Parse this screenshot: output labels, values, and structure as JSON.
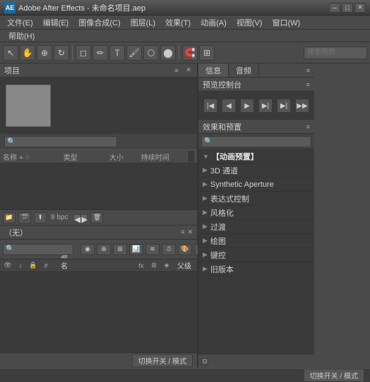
{
  "titleBar": {
    "logo": "AE",
    "title": "Adobe After Effects - 未命名项目.aep",
    "minBtn": "─",
    "maxBtn": "□",
    "closeBtn": "✕"
  },
  "menuBar": {
    "items": [
      {
        "id": "file",
        "label": "文件(E)"
      },
      {
        "id": "edit",
        "label": "编辑(E)"
      },
      {
        "id": "composition",
        "label": "图像合成(C)"
      },
      {
        "id": "layer",
        "label": "图层(L)"
      },
      {
        "id": "effect",
        "label": "效果(T)"
      },
      {
        "id": "animation",
        "label": "动画(A)"
      },
      {
        "id": "view",
        "label": "视图(V)"
      },
      {
        "id": "window",
        "label": "窗口(W)"
      }
    ],
    "helpItem": "帮助(H)"
  },
  "toolbar": {
    "tools": [
      "↖",
      "✋",
      "↔",
      "⊕",
      "⟺",
      "✏",
      "T",
      "☁",
      "⬡"
    ],
    "searchPlaceholder": "搜索帮助"
  },
  "projectPanel": {
    "title": "项目",
    "searchPlaceholder": "",
    "tableHeaders": {
      "name": "名称",
      "sortAsc": "▲",
      "tag": "◇",
      "type": "类型",
      "size": "大小",
      "duration": "持续时间"
    },
    "bottomBar": {
      "bpcLabel": "8 bpc"
    }
  },
  "infoAudioTabs": {
    "tabs": [
      "信息",
      "音频"
    ]
  },
  "previewPanel": {
    "title": "预览控制台"
  },
  "effectsPanel": {
    "title": "效果和预置",
    "searchPlaceholder": "🔍",
    "items": [
      {
        "id": "animation-presets",
        "label": "【动画预置】",
        "type": "header",
        "expanded": true
      },
      {
        "id": "3d-channel",
        "label": "3D 通道",
        "type": "folder"
      },
      {
        "id": "synthetic-aperture",
        "label": "Synthetic Aperture",
        "type": "folder"
      },
      {
        "id": "expression-controls",
        "label": "表达式控制",
        "type": "folder"
      },
      {
        "id": "stylize",
        "label": "风格化",
        "type": "folder"
      },
      {
        "id": "transition",
        "label": "过渡",
        "type": "folder"
      },
      {
        "id": "draw",
        "label": "绘图",
        "type": "folder"
      },
      {
        "id": "keying",
        "label": "键控",
        "type": "folder"
      },
      {
        "id": "old-version",
        "label": "旧版本",
        "type": "folder"
      }
    ]
  },
  "timelinePanel": {
    "title": "（无）",
    "switchBtn": "切换开关 / 模式"
  }
}
